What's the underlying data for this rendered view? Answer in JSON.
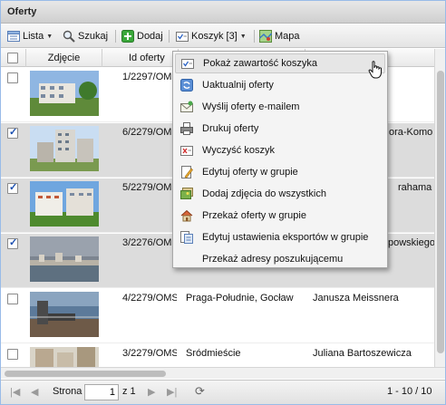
{
  "panel": {
    "title": "Oferty"
  },
  "toolbar": {
    "list_label": "Lista",
    "search_label": "Szukaj",
    "add_label": "Dodaj",
    "basket_label": "Koszyk [3]",
    "map_label": "Mapa"
  },
  "columns": {
    "photo": "Zdjęcie",
    "id": "Id oferty"
  },
  "rows": [
    {
      "id": "1/2297/OMS",
      "district": "",
      "street": "",
      "selected": false
    },
    {
      "id": "6/2279/OMS",
      "district": "",
      "street": "ora-Komo",
      "selected": true
    },
    {
      "id": "5/2279/OMS",
      "district": "",
      "street": "rahama",
      "selected": true
    },
    {
      "id": "3/2276/OMS",
      "district": "",
      "street": "powskiego",
      "selected": true
    },
    {
      "id": "4/2279/OMS",
      "district": "Praga-Południe, Gocław",
      "street": "Janusza Meissnera",
      "selected": false
    },
    {
      "id": "3/2279/OMS",
      "district": "Śródmieście",
      "street": "Juliana Bartoszewicza",
      "selected": false
    }
  ],
  "menu": {
    "items": [
      {
        "label": "Pokaż zawartość koszyka",
        "icon": "basket-check-icon"
      },
      {
        "label": "Uaktualnij oferty",
        "icon": "refresh-icon"
      },
      {
        "label": "Wyślij oferty e-mailem",
        "icon": "email-icon"
      },
      {
        "label": "Drukuj oferty",
        "icon": "printer-icon"
      },
      {
        "label": "Wyczyść koszyk",
        "icon": "clear-basket-icon"
      },
      {
        "label": "Edytuj oferty w grupie",
        "icon": "edit-icon"
      },
      {
        "label": "Dodaj zdjęcia do wszystkich",
        "icon": "photos-icon"
      },
      {
        "label": "Przekaż oferty w grupie",
        "icon": "transfer-house-icon"
      },
      {
        "label": "Edytuj ustawienia eksportów w grupie",
        "icon": "export-settings-icon"
      },
      {
        "label": "Przekaż adresy poszukującemu",
        "icon": ""
      }
    ]
  },
  "pager": {
    "page_label": "Strona",
    "page_value": "1",
    "of_label": "z 1",
    "summary": "1 - 10 / 10"
  }
}
